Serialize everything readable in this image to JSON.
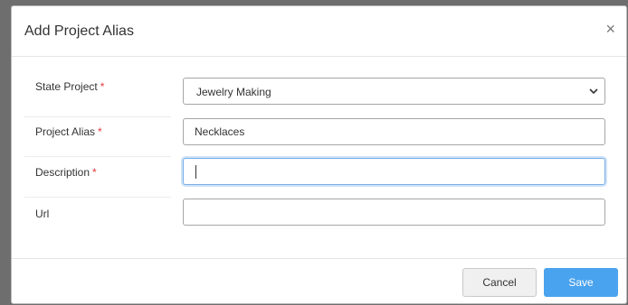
{
  "dialog": {
    "title": "Add Project Alias",
    "close_symbol": "×"
  },
  "form": {
    "state_project": {
      "label": "State Project",
      "required_mark": "*",
      "value": "Jewelry Making"
    },
    "project_alias": {
      "label": "Project Alias",
      "required_mark": "*",
      "value": "Necklaces"
    },
    "description": {
      "label": "Description",
      "required_mark": "*",
      "value": ""
    },
    "url": {
      "label": "Url",
      "value": ""
    }
  },
  "footer": {
    "cancel_label": "Cancel",
    "save_label": "Save"
  },
  "colors": {
    "primary": "#4aa3ee",
    "required": "#e5383b",
    "focus_border": "#79aee9"
  }
}
